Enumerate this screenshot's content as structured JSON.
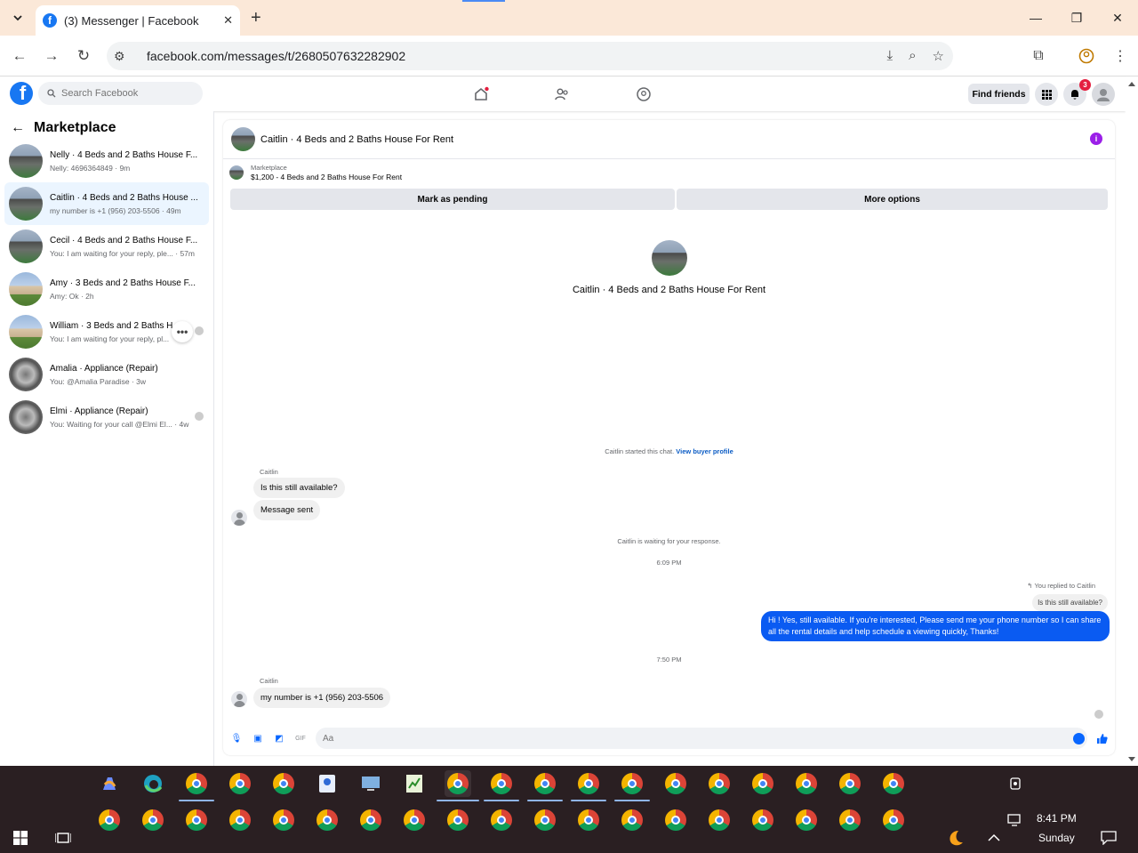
{
  "browser": {
    "tab_title": "(3) Messenger | Facebook",
    "url": "facebook.com/messages/t/2680507632282902"
  },
  "fb": {
    "search_placeholder": "Search Facebook",
    "find_friends": "Find friends",
    "notif_count": "3"
  },
  "sidebar": {
    "title": "Marketplace",
    "conversations": [
      {
        "name": "Nelly · 4 Beds and 2 Baths House F...",
        "sub": "Nelly: 4696364849 · 9m"
      },
      {
        "name": "Caitlin · 4 Beds and 2 Baths House ...",
        "sub": "my number is +1 (956) 203-5506 · 49m"
      },
      {
        "name": "Cecil · 4 Beds and 2 Baths House F...",
        "sub": "You: I am waiting for your reply, ple...  · 57m"
      },
      {
        "name": "Amy · 3 Beds and 2 Baths House F...",
        "sub": "Amy: Ok · 2h"
      },
      {
        "name": "William · 3 Beds and 2 Baths H",
        "sub": "You: I am waiting for your reply, pl..."
      },
      {
        "name": "Amalia · Appliance (Repair)",
        "sub": "You: @Amalia Paradise · 3w"
      },
      {
        "name": "Elmi · Appliance (Repair)",
        "sub": "You: Waiting for your call @Elmi El...  · 4w"
      }
    ]
  },
  "chat": {
    "title": "Caitlin · 4 Beds and 2 Baths House For Rent",
    "listing_label": "Marketplace",
    "listing_price": "$1,200 - 4 Beds and 2 Baths House For Rent",
    "mark_pending": "Mark as pending",
    "more_options": "More options",
    "intro_name": "Caitlin · 4 Beds and 2 Baths House For Rent",
    "started_text": "Caitlin started this chat.",
    "view_profile": "View buyer profile",
    "sender_name": "Caitlin",
    "msg1": "Is this still available?",
    "msg2": "Message sent",
    "waiting": "Caitlin is waiting for your response.",
    "time1": "6:09 PM",
    "replied_label": "You replied to Caitlin",
    "quoted": "Is this still available?",
    "reply": "Hi ! Yes, still available. If you're interested, Please send me your phone number so I can share all the rental details and help schedule a viewing quickly, Thanks!",
    "time2": "7:50 PM",
    "msg3": "my number is +1 (956) 203-5506",
    "composer_placeholder": "Aa"
  },
  "taskbar": {
    "time": "8:41 PM",
    "day": "Sunday"
  },
  "colors": {
    "fb_blue": "#1877f2",
    "messenger_blue": "#0a5bf2",
    "active_conv": "#ebf5ff"
  }
}
